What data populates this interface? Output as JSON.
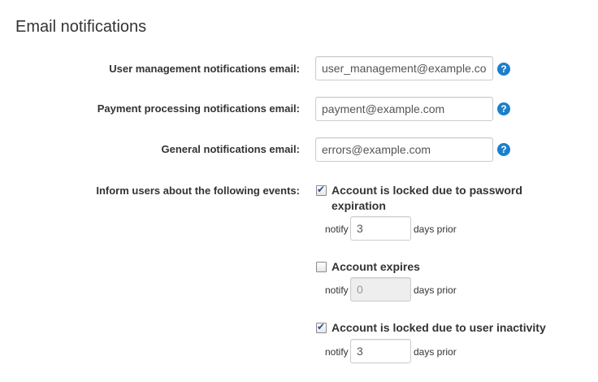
{
  "section": {
    "title": "Email notifications"
  },
  "fields": {
    "user_management": {
      "label": "User management notifications email:",
      "value": "user_management@example.com"
    },
    "payment_processing": {
      "label": "Payment processing notifications email:",
      "value": "payment@example.com"
    },
    "general": {
      "label": "General notifications email:",
      "value": "errors@example.com"
    }
  },
  "help_icon_glyph": "?",
  "events": {
    "label": "Inform users about the following events:",
    "notify_text": "notify",
    "days_text": "days prior",
    "items": [
      {
        "label_line1": "Account is locked due to password",
        "label_line2": "expiration",
        "checked": true,
        "days": "3"
      },
      {
        "label_line1": "Account expires",
        "checked": false,
        "days": "0"
      },
      {
        "label_line1": "Account is locked due to user inactivity",
        "checked": true,
        "days": "3"
      }
    ]
  },
  "colors": {
    "help_icon": "#1b7fcc",
    "checkmark": "#2d4f8a",
    "disabled_input": "#eeeeee"
  }
}
